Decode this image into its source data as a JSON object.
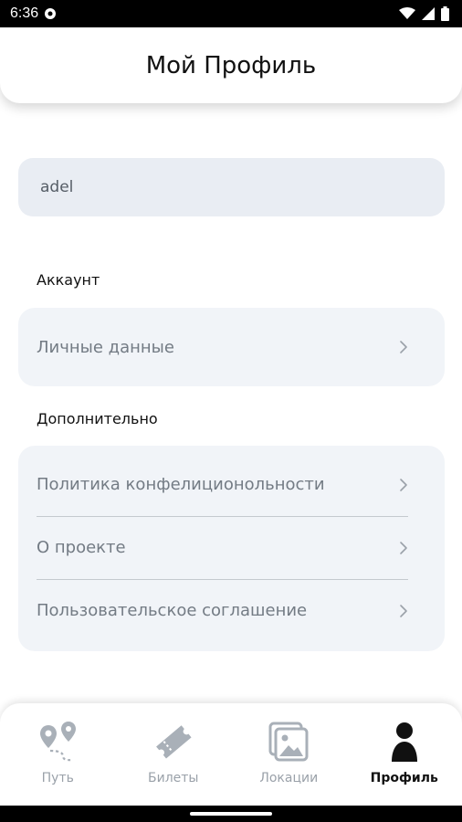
{
  "status_bar": {
    "time": "6:36"
  },
  "header": {
    "title": "Мой Профиль"
  },
  "profile": {
    "username": "adel"
  },
  "sections": {
    "account": {
      "title": "Аккаунт",
      "items": [
        {
          "label": "Личные данные"
        }
      ]
    },
    "extra": {
      "title": "Дополнительно",
      "items": [
        {
          "label": "Политика конфелиционольности"
        },
        {
          "label": "О проекте"
        },
        {
          "label": "Пользовательское соглашение"
        }
      ]
    }
  },
  "bottom_nav": {
    "items": [
      {
        "label": "Путь",
        "icon": "route-icon",
        "active": false
      },
      {
        "label": "Билеты",
        "icon": "ticket-icon",
        "active": false
      },
      {
        "label": "Локации",
        "icon": "gallery-icon",
        "active": false
      },
      {
        "label": "Профиль",
        "icon": "person-icon",
        "active": true
      }
    ]
  },
  "colors": {
    "field_bg": "#e9edf3",
    "card_bg": "#f1f4f8",
    "inactive_nav": "#9aa1a9",
    "active_nav": "#111111"
  }
}
